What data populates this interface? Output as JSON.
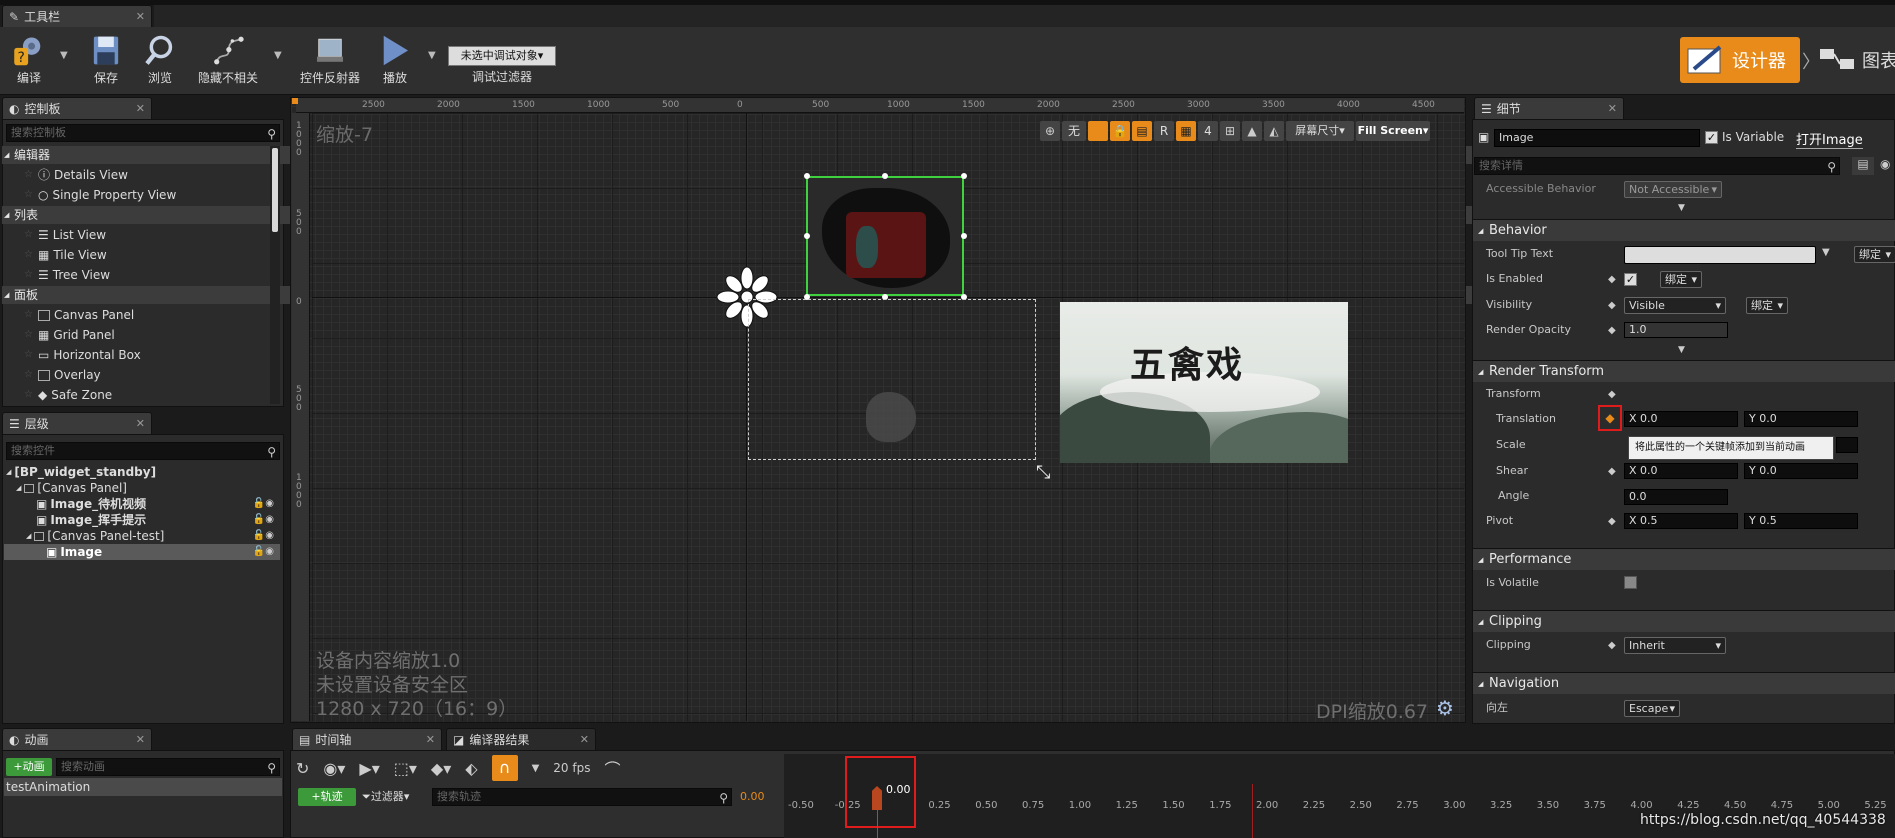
{
  "toolbar_tab": {
    "title": "工具栏"
  },
  "toolbar": {
    "compile": "编译",
    "save": "保存",
    "browse": "浏览",
    "hide_unrelated": "隐藏不相关",
    "widget_reflector": "控件反射器",
    "play": "播放",
    "debug_object": "未选中调试对象▾",
    "debug_filter": "调试过滤器"
  },
  "mode": {
    "designer": "设计器",
    "graph": "图表"
  },
  "palette": {
    "tab": "控制板",
    "search_placeholder": "搜索控制板",
    "categories": [
      {
        "label": "编辑器",
        "items": [
          "Details View",
          "Single Property View"
        ]
      },
      {
        "label": "列表",
        "items": [
          "List View",
          "Tile View",
          "Tree View"
        ]
      },
      {
        "label": "面板",
        "items": [
          "Canvas Panel",
          "Grid Panel",
          "Horizontal Box",
          "Overlay",
          "Safe Zone"
        ]
      }
    ]
  },
  "hierarchy": {
    "tab": "层级",
    "search_placeholder": "搜索控件",
    "items": [
      "[BP_widget_standby]",
      "[Canvas Panel]",
      "Image_待机视频",
      "Image_挥手提示",
      "[Canvas Panel-test]",
      "Image"
    ]
  },
  "viewport": {
    "zoom": "缩放-7",
    "ruler_top": [
      "2500",
      "2000",
      "1500",
      "1000",
      "500",
      "0",
      "500",
      "1000",
      "1500",
      "2000",
      "2500",
      "3000",
      "3500",
      "4000",
      "4500"
    ],
    "ruler_left": [
      "1000",
      "500",
      "0",
      "500",
      "1000"
    ],
    "toolbar": {
      "none": "无",
      "r": "R",
      "four": "4",
      "screen_size": "屏幕尺寸▾",
      "fill_screen": "Fill Screen▾"
    },
    "info": [
      "设备内容缩放1.0",
      "未设置设备安全区",
      "1280 x 720（16：9）"
    ],
    "dpi": "DPI缩放0.67",
    "image_title": "五禽戏"
  },
  "details": {
    "tab": "细节",
    "name": "Image",
    "is_variable": "Is Variable",
    "open_image": "打开Image",
    "search_placeholder": "搜索详情",
    "accessible_behavior": {
      "label": "Accessible Behavior",
      "value": "Not Accessible"
    },
    "behavior": {
      "title": "Behavior",
      "tooltip": "Tool Tip Text",
      "bind": "绑定",
      "is_enabled": "Is Enabled",
      "visibility": "Visibility",
      "visibility_value": "Visible",
      "render_opacity": "Render Opacity",
      "render_opacity_value": "1.0"
    },
    "render_transform": {
      "title": "Render Transform",
      "transform": "Transform",
      "translation": "Translation",
      "tx": "X  0.0",
      "ty": "Y  0.0",
      "scale": "Scale",
      "shear": "Shear",
      "shx": "X  0.0",
      "shy": "Y  0.0",
      "angle": "Angle",
      "angle_value": "0.0",
      "pivot": "Pivot",
      "px": "X  0.5",
      "py": "Y  0.5",
      "tooltip": "将此属性的一个关键帧添加到当前动画"
    },
    "performance": {
      "title": "Performance",
      "is_volatile": "Is Volatile"
    },
    "clipping": {
      "title": "Clipping",
      "label": "Clipping",
      "value": "Inherit"
    },
    "navigation": {
      "title": "Navigation",
      "left": "向左",
      "left_value": "Escape"
    }
  },
  "animation": {
    "tab": "动画",
    "add": "+动画",
    "search_placeholder": "搜索动画",
    "items": [
      "testAnimation"
    ]
  },
  "timeline": {
    "tab": "时间轴",
    "compiler_tab": "编译器结果",
    "track": "+轨迹",
    "filter": "过滤器",
    "search_placeholder": "搜索轨迹",
    "time_value": "0.00",
    "fps": "20 fps",
    "playhead": "0.00",
    "ticks": [
      "-0.50",
      "-0.25",
      "0.25",
      "0.50",
      "0.75",
      "1.00",
      "1.25",
      "1.50",
      "1.75",
      "2.00",
      "2.25",
      "2.50",
      "2.75",
      "3.00",
      "3.25",
      "3.50",
      "3.75",
      "4.00",
      "4.25",
      "4.50",
      "4.75",
      "5.00",
      "5.25"
    ]
  },
  "watermark": "https://blog.csdn.net/qq_40544338"
}
